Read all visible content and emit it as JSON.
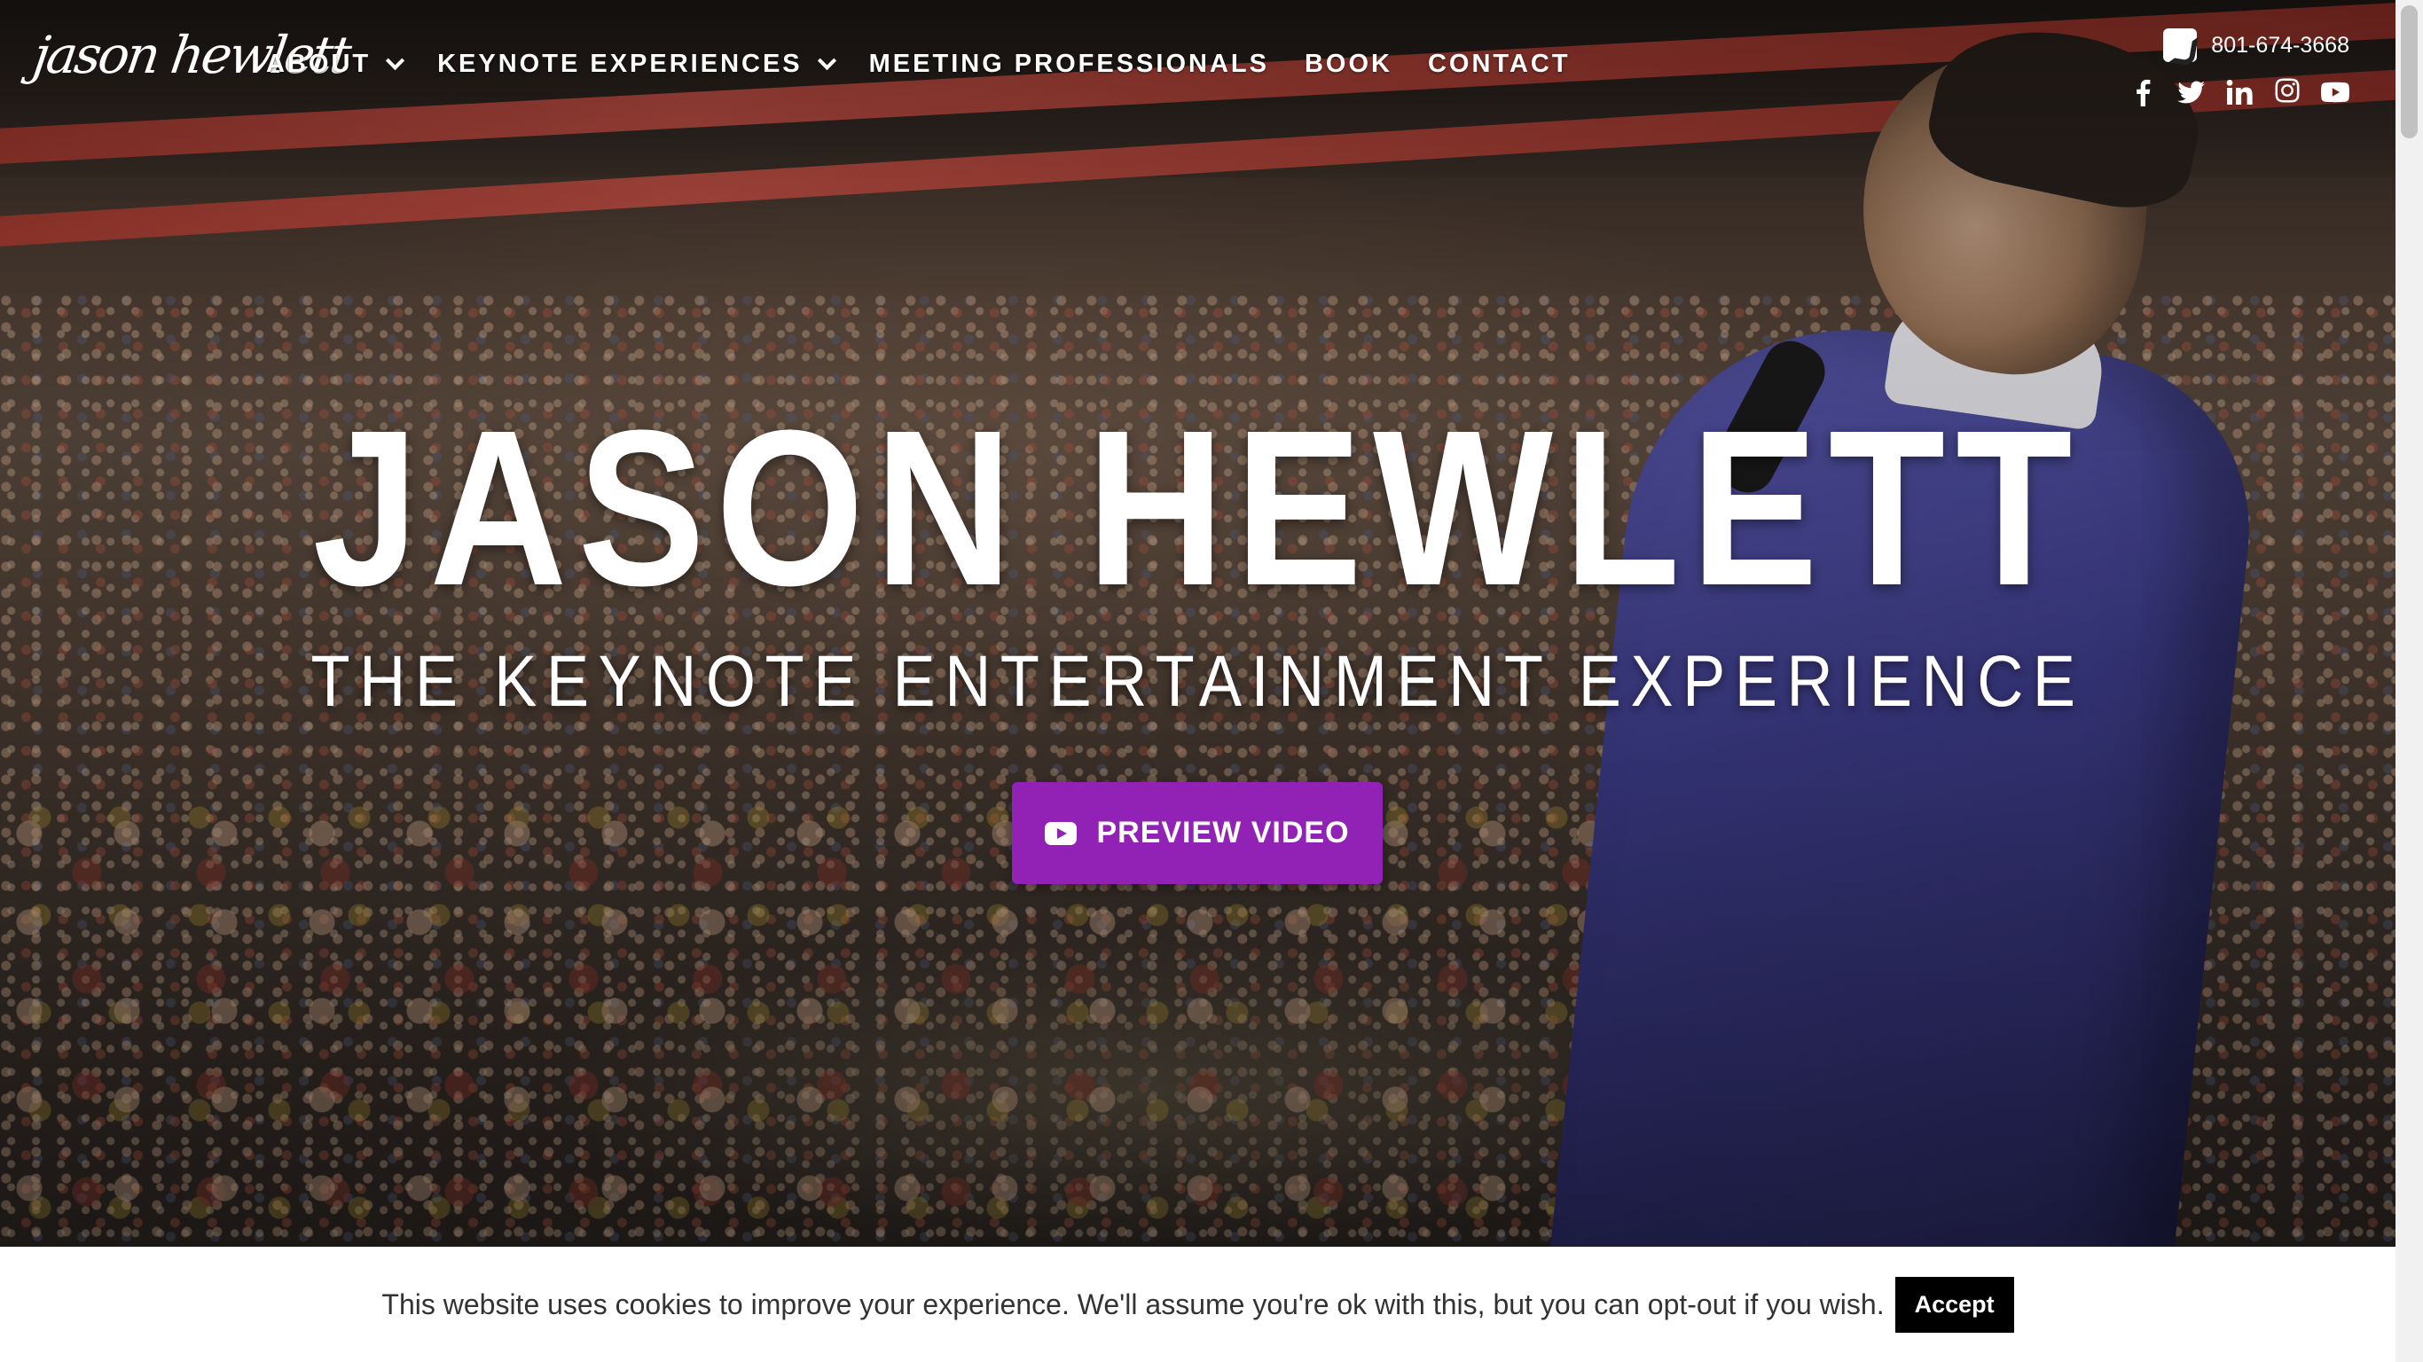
{
  "header": {
    "logo_text": "jason hewlett",
    "nav": [
      {
        "label": "ABOUT",
        "has_dropdown": true
      },
      {
        "label": "KEYNOTE EXPERIENCES",
        "has_dropdown": true
      },
      {
        "label": "MEETING PROFESSIONALS",
        "has_dropdown": false
      },
      {
        "label": "BOOK",
        "has_dropdown": false
      },
      {
        "label": "CONTACT",
        "has_dropdown": false
      }
    ],
    "phone": "801-674-3668",
    "social_icons": [
      "facebook-icon",
      "twitter-icon",
      "linkedin-icon",
      "instagram-icon",
      "youtube-icon"
    ]
  },
  "hero": {
    "title": "JASON HEWLETT",
    "subtitle": "THE KEYNOTE ENTERTAINMENT EXPERIENCE",
    "cta_label": "PREVIEW VIDEO",
    "cta_color": "#9122b5"
  },
  "cookie": {
    "message": "This website uses cookies to improve your experience. We'll assume you're ok with this, but you can opt-out if you wish.",
    "accept_label": "Accept"
  }
}
